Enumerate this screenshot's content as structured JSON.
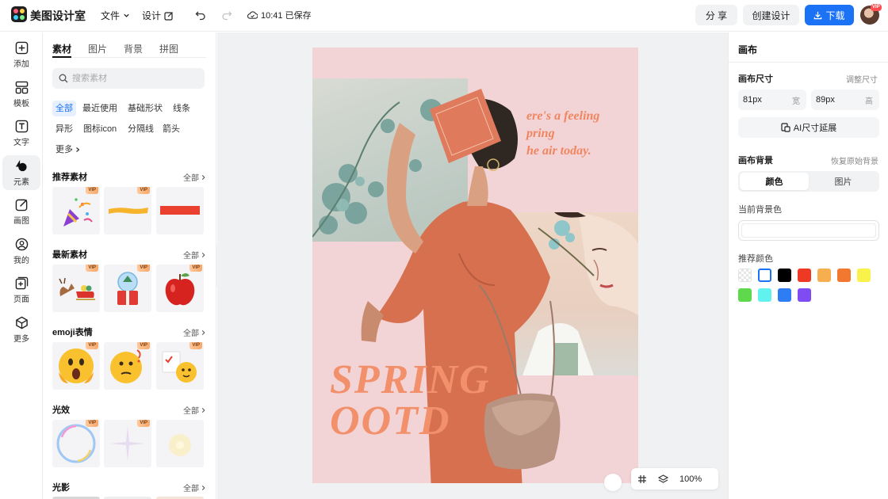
{
  "app": {
    "name": "美图设计室"
  },
  "header": {
    "file_label": "文件",
    "design_label": "设计",
    "saved_status": "10:41 已保存",
    "share_label": "分 享",
    "create_label": "创建设计",
    "download_label": "下载",
    "avatar_badge": "VIP"
  },
  "rail": {
    "items": [
      {
        "label": "添加",
        "icon": "plus-square-icon"
      },
      {
        "label": "模板",
        "icon": "template-icon"
      },
      {
        "label": "文字",
        "icon": "text-icon"
      },
      {
        "label": "元素",
        "icon": "shapes-icon"
      },
      {
        "label": "画图",
        "icon": "draw-icon"
      },
      {
        "label": "我的",
        "icon": "user-icon"
      },
      {
        "label": "页面",
        "icon": "add-page-icon"
      },
      {
        "label": "更多",
        "icon": "cube-icon"
      }
    ],
    "active_index": 3
  },
  "panel": {
    "tabs": [
      "素材",
      "图片",
      "背景",
      "拼图"
    ],
    "search_placeholder": "搜索素材",
    "chips": [
      "全部",
      "最近使用",
      "基础形状",
      "线条",
      "异形",
      "图标icon",
      "分隔线",
      "箭头",
      "更多"
    ],
    "all_label": "全部",
    "vip_label": "VIP",
    "sections": [
      "推荐素材",
      "最新素材",
      "emoji表情",
      "光效",
      "光影"
    ]
  },
  "artboard": {
    "quote": [
      "ere's a feeling",
      "pring",
      "he air today."
    ],
    "headline": [
      "SPRING",
      "OOTD"
    ]
  },
  "zoom": {
    "level": "100%"
  },
  "props": {
    "title": "画布",
    "size_label": "画布尺寸",
    "adjust_size": "调整尺寸",
    "width_value": "81px",
    "width_unit": "宽",
    "height_value": "89px",
    "height_unit": "高",
    "ai_extend": "AI尺寸延展",
    "bg_label": "画布背景",
    "restore_bg": "恢复原始背景",
    "bg_tabs": [
      "颜色",
      "图片"
    ],
    "current_bg": "当前背景色",
    "recommended": "推荐颜色"
  },
  "colors": {
    "accent": "#1b72f5",
    "swatches": [
      "transparent",
      "#ffffff",
      "#000000",
      "#ee3a25",
      "#f6ae4f",
      "#f1782e",
      "#f9f24a",
      "#5ed94c",
      "#61f2f0",
      "#2e7df5",
      "#7e4cf2"
    ]
  }
}
